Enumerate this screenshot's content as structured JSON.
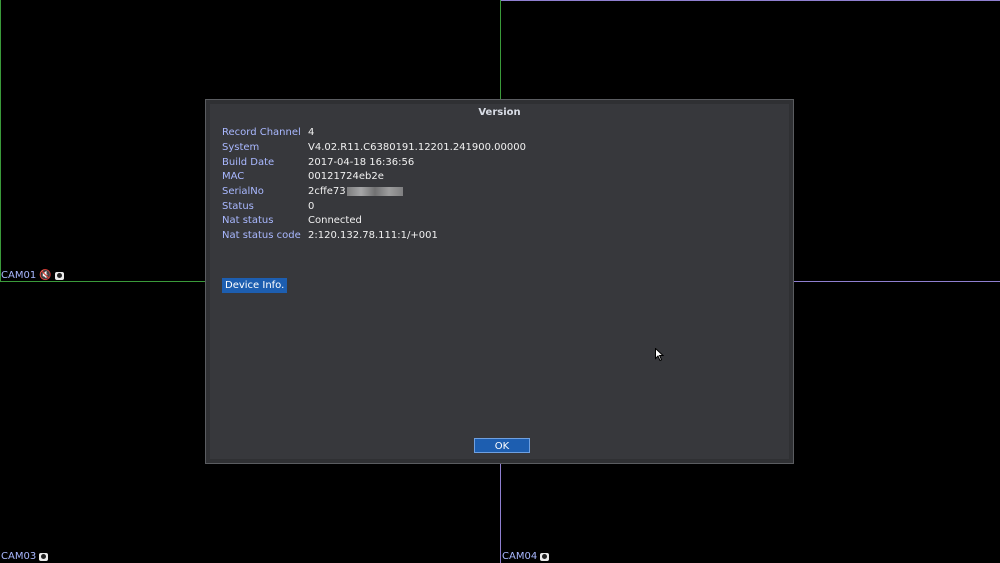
{
  "cameras": [
    {
      "label": "CAM01"
    },
    {
      "label": "CAM03"
    },
    {
      "label": "CAM04"
    }
  ],
  "dialog": {
    "title": "Version",
    "rows": [
      {
        "label": "Record Channel",
        "value": "4"
      },
      {
        "label": "System",
        "value": "V4.02.R11.C6380191.12201.241900.00000"
      },
      {
        "label": "Build Date",
        "value": "2017-04-18 16:36:56"
      },
      {
        "label": "MAC",
        "value": "00121724eb2e"
      },
      {
        "label": "SerialNo",
        "value": "2cffe73"
      },
      {
        "label": "Status",
        "value": "0"
      },
      {
        "label": "Nat status",
        "value": "Connected"
      },
      {
        "label": "Nat status code",
        "value": "2:120.132.78.111:1/+001"
      }
    ],
    "device_info_label": "Device Info.",
    "ok_label": "OK"
  },
  "colors": {
    "grid_line_green": "#3a9a3a",
    "grid_line_purple": "#8f7fd0",
    "label_blue": "#a9b8ff",
    "button_blue": "#1d5eb0"
  }
}
